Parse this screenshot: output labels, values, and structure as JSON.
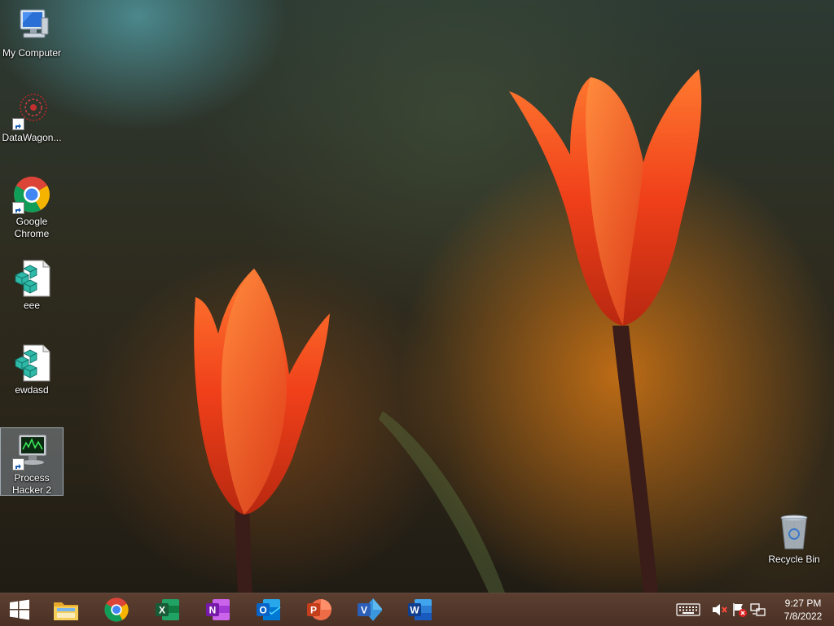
{
  "desktop": {
    "icons": [
      {
        "label": "My Computer",
        "icon": "my-computer-icon"
      },
      {
        "label": "DataWagon...",
        "icon": "datawagon-icon"
      },
      {
        "label": "Google\nChrome",
        "icon": "chrome-icon"
      },
      {
        "label": "eee",
        "icon": "registry-file-icon"
      },
      {
        "label": "ewdasd",
        "icon": "registry-file-icon"
      },
      {
        "label": "Process\nHacker 2",
        "icon": "process-hacker-icon",
        "selected": true
      },
      {
        "label": "Recycle Bin",
        "icon": "recycle-bin-icon"
      }
    ]
  },
  "taskbar": {
    "start": "start-button",
    "pinned": [
      {
        "name": "File Explorer",
        "icon": "file-explorer-icon",
        "color": "#f2c14e"
      },
      {
        "name": "Google Chrome",
        "icon": "chrome-icon",
        "color": "#db4437"
      },
      {
        "name": "Excel",
        "icon": "excel-icon",
        "color": "#1d6f42",
        "letter": "X"
      },
      {
        "name": "OneNote",
        "icon": "onenote-icon",
        "color": "#7719aa",
        "letter": "N"
      },
      {
        "name": "Outlook",
        "icon": "outlook-icon",
        "color": "#0a64c8",
        "letter": "O"
      },
      {
        "name": "PowerPoint",
        "icon": "powerpoint-icon",
        "color": "#d24726",
        "letter": "P"
      },
      {
        "name": "Visio",
        "icon": "visio-icon",
        "color": "#2b5fb8",
        "letter": "V"
      },
      {
        "name": "Word",
        "icon": "word-icon",
        "color": "#2b579a",
        "letter": "W"
      }
    ],
    "tray": [
      "keyboard-icon",
      "volume-muted-icon",
      "action-center-flag-icon",
      "network-icon"
    ],
    "clock": {
      "time": "9:27 PM",
      "date": "7/8/2022"
    }
  }
}
